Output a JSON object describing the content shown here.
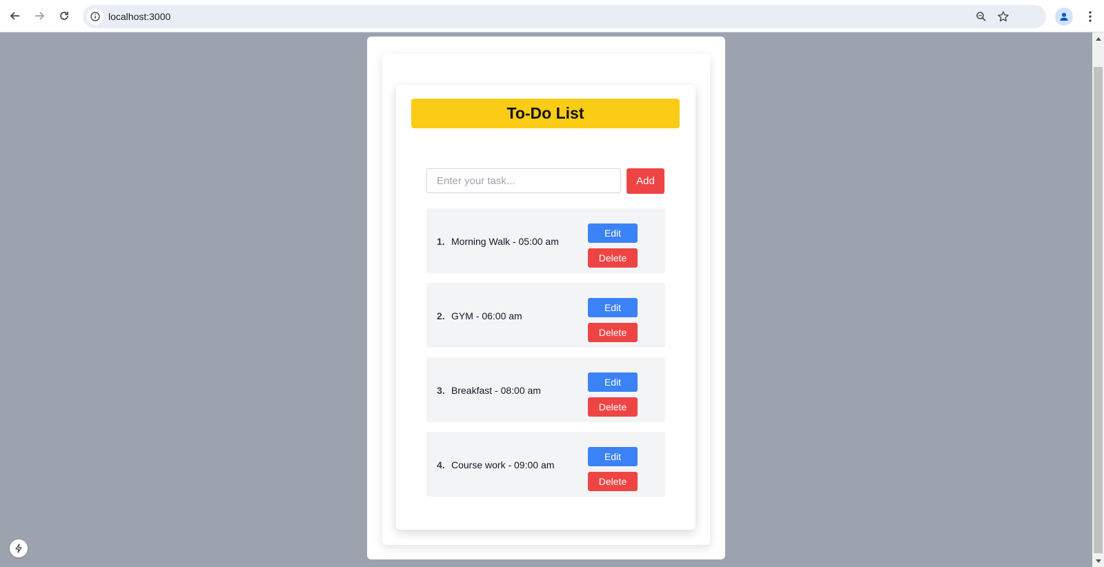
{
  "browser": {
    "url": "localhost:3000",
    "icons": {
      "back": "back-arrow-icon",
      "forward": "forward-arrow-icon",
      "reload": "reload-icon",
      "site_info": "info-icon",
      "zoom": "zoom-icon",
      "bookmark": "star-icon",
      "profile": "profile-icon",
      "menu": "more-vert-icon"
    }
  },
  "app": {
    "title": "To-Do List",
    "input_placeholder": "Enter your task...",
    "input_value": "",
    "add_label": "Add",
    "edit_label": "Edit",
    "delete_label": "Delete",
    "tasks": [
      {
        "number": "1.",
        "text": "Morning Walk - 05:00 am"
      },
      {
        "number": "2.",
        "text": "GYM - 06:00 am"
      },
      {
        "number": "3.",
        "text": "Breakfast - 08:00 am"
      },
      {
        "number": "4.",
        "text": "Course work - 09:00 am"
      }
    ]
  },
  "colors": {
    "page_bg": "#9ca3af",
    "title_bg": "#facc15",
    "add_bg": "#ef4444",
    "edit_bg": "#3b82f6",
    "delete_bg": "#ef4444",
    "item_bg": "#f3f4f6"
  }
}
